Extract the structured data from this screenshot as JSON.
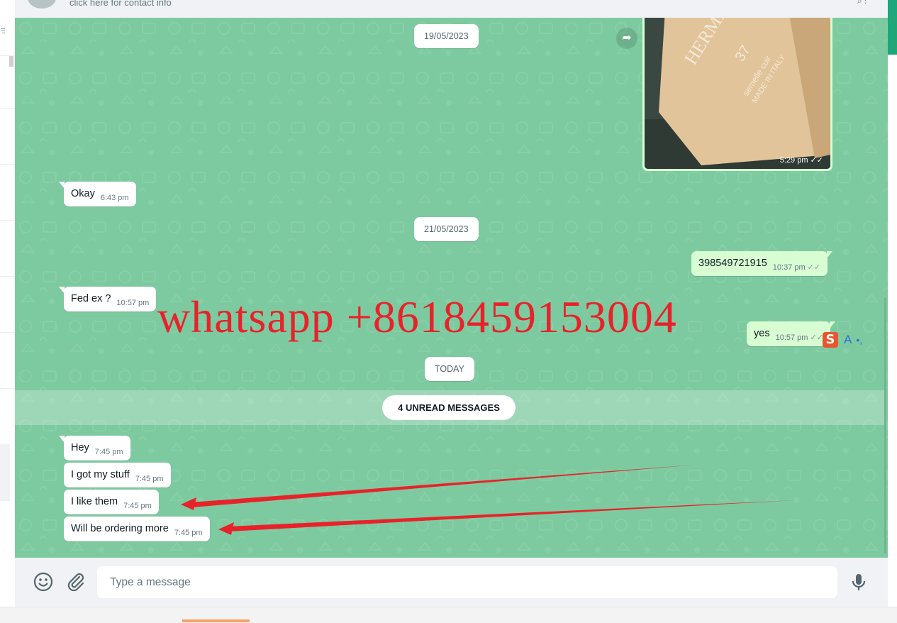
{
  "header": {
    "contact_subtitle": "click here for contact info"
  },
  "chat": {
    "dates": [
      "19/05/2023",
      "21/05/2023",
      "TODAY"
    ],
    "image_message": {
      "time": "5:29 pm",
      "label_lines": [
        "HERME",
        "37",
        "semelle cuir",
        "MADE IN ITALY"
      ]
    },
    "messages": [
      {
        "text": "Okay",
        "time": "6:43 pm",
        "direction": "in"
      },
      {
        "text": "398549721915",
        "time": "10:37 pm",
        "direction": "out"
      },
      {
        "text": "Fed ex ?",
        "time": "10:57 pm",
        "direction": "in"
      },
      {
        "text": "yes",
        "time": "10:57 pm",
        "direction": "out"
      },
      {
        "text": "Hey",
        "time": "7:45 pm",
        "direction": "in"
      },
      {
        "text": "I got my stuff",
        "time": "7:45 pm",
        "direction": "in"
      },
      {
        "text": "I like them",
        "time": "7:45 pm",
        "direction": "in"
      },
      {
        "text": "Will be ordering more",
        "time": "7:45 pm",
        "direction": "in"
      }
    ],
    "unread_label": "4 UNREAD MESSAGES",
    "watermark": "whatsapp +8618459153004",
    "ime": {
      "s": "S",
      "a": "A",
      "dots": "•,"
    }
  },
  "composer": {
    "placeholder": "Type a message"
  },
  "colors": {
    "chat_bg": "#7dcaa0",
    "outgoing_bubble": "#d9fdd3",
    "incoming_bubble": "#ffffff",
    "accent": "#1fa779",
    "annotation_red": "#e8222a"
  },
  "icons": [
    "filter-icon",
    "avatar",
    "forward-icon",
    "double-check-icon",
    "emoji-icon",
    "attach-icon",
    "mic-icon"
  ]
}
